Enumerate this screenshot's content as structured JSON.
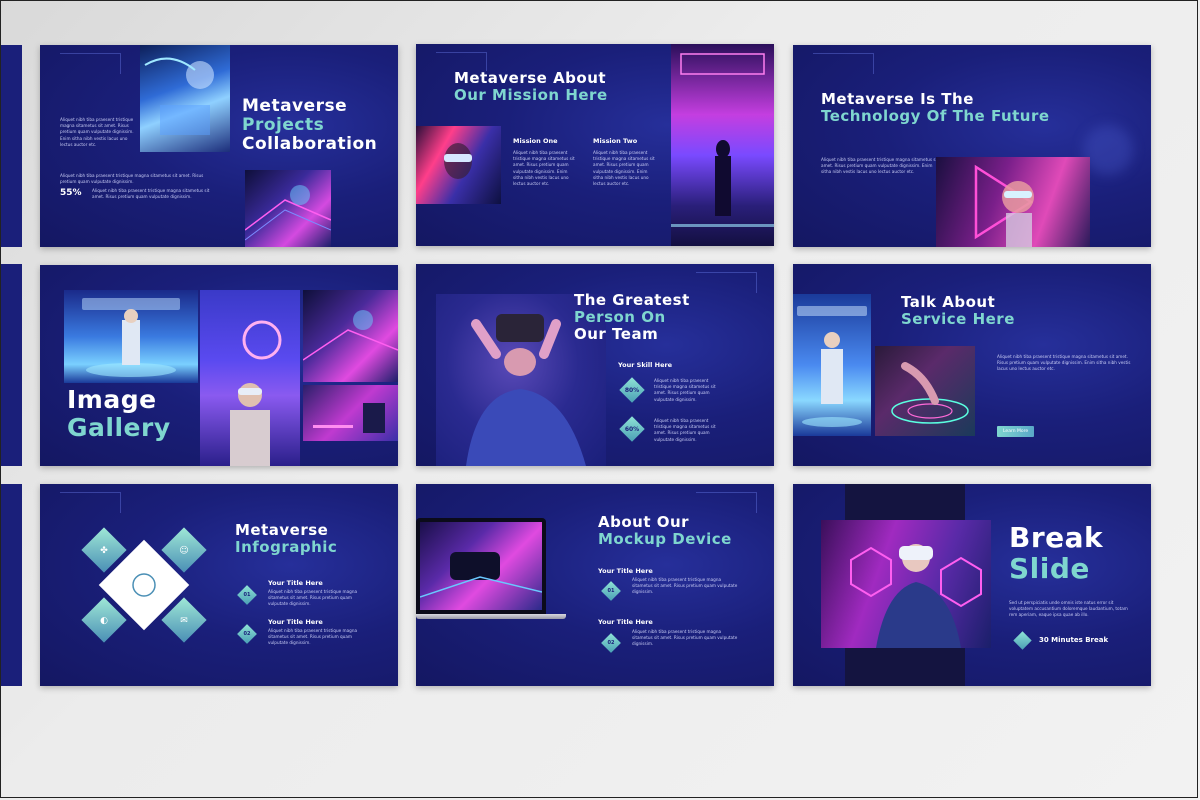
{
  "lorem_long": "Aliquet nibh tiba praesent tristique magna sitametus sit amet. Risus pretium quam vulputate dignissim. Enim sitha nibh vestis lacus uno lectus auctor etc.",
  "lorem_short": "Aliquet nibh tiba praesent tristique magna sitametus sit amet. Risus pretium quam vulputate dignissim.",
  "slides": {
    "s1": {
      "title_1": "Metaverse",
      "title_2": "Projects",
      "title_3": "Collaboration",
      "stat": "55%"
    },
    "s2": {
      "title_1": "Metaverse About",
      "title_2": "Our Mission Here",
      "mission_one": "Mission One",
      "mission_two": "Mission Two"
    },
    "s3": {
      "title_1": "Metaverse Is The",
      "title_2": "Technology Of The Future"
    },
    "s4": {
      "title_1": "Image",
      "title_2": "Gallery"
    },
    "s5": {
      "title_1": "The Greatest",
      "title_2": "Person On",
      "title_3": "Our Team",
      "skill_title": "Your Skill Here",
      "skill_1": "80%",
      "skill_2": "60%"
    },
    "s6": {
      "title_1": "Talk About",
      "title_2": "Service Here",
      "button": "Learn More"
    },
    "s7": {
      "title_1": "Metaverse",
      "title_2": "Infographic",
      "item_title": "Your Title Here",
      "num_1": "01",
      "num_2": "02"
    },
    "s8": {
      "title_1": "About Our",
      "title_2": "Mockup Device",
      "item_title": "Your Title Here",
      "num_1": "01",
      "num_2": "02"
    },
    "s9": {
      "title_1": "Break",
      "title_2": "Slide",
      "caption": "30 Minutes Break",
      "body": "Sed ut perspiciatis unde omnis iste natus error sit voluptatem accusantium doloremque laudantium, totam rem aperiam, eaque ipsa quae ab illo."
    }
  },
  "colors": {
    "slide_bg": "#1a1f7a",
    "accent": "#7fd6cf",
    "neon_pink": "#e048d8",
    "neon_blue": "#4a7dff"
  }
}
